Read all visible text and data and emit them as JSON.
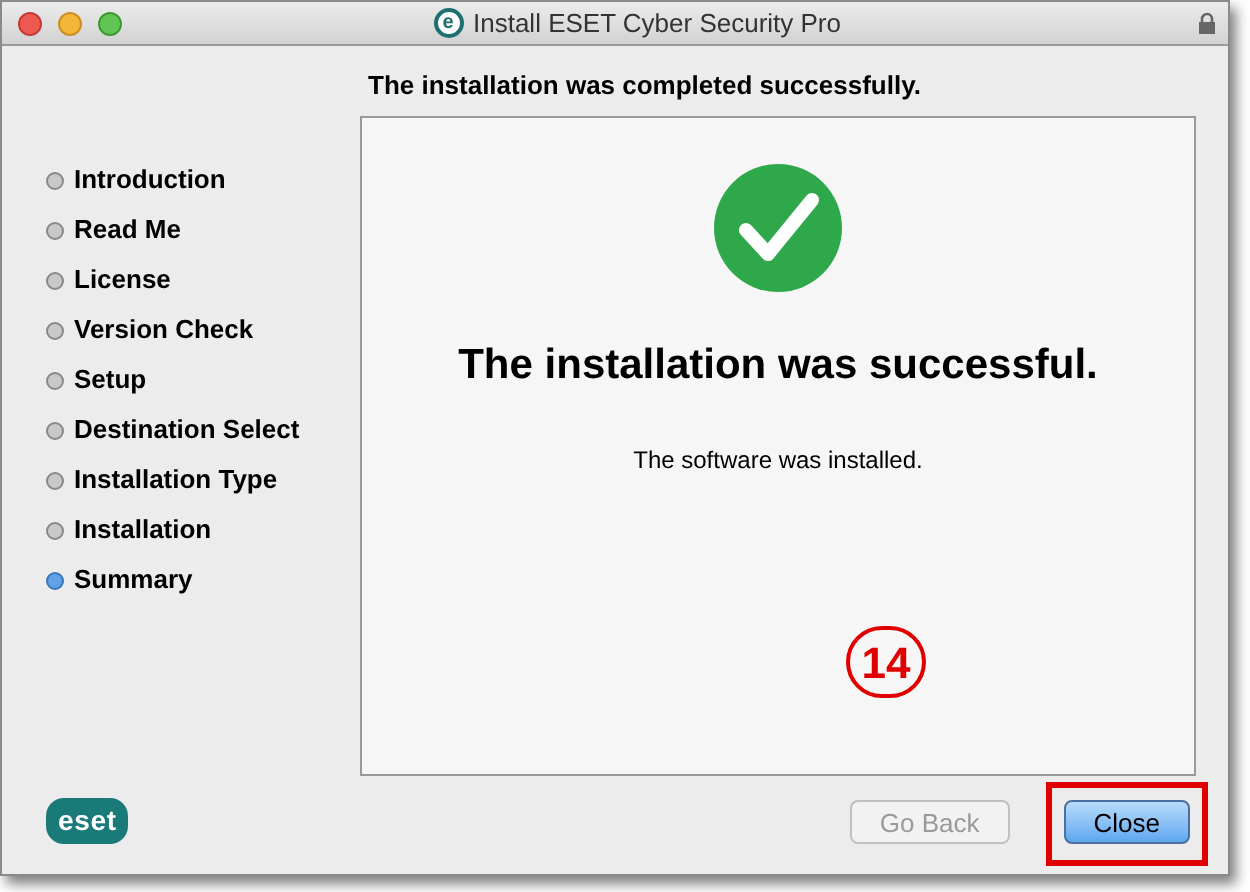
{
  "window": {
    "title": "Install ESET Cyber Security Pro",
    "title_icon": "e"
  },
  "header": "The installation was completed successfully.",
  "steps": [
    {
      "label": "Introduction",
      "selected": false
    },
    {
      "label": "Read Me",
      "selected": false
    },
    {
      "label": "License",
      "selected": false
    },
    {
      "label": "Version Check",
      "selected": false
    },
    {
      "label": "Setup",
      "selected": false
    },
    {
      "label": "Destination Select",
      "selected": false
    },
    {
      "label": "Installation Type",
      "selected": false
    },
    {
      "label": "Installation",
      "selected": false
    },
    {
      "label": "Summary",
      "selected": true
    }
  ],
  "content": {
    "title": "The installation was successful.",
    "message": "The software was installed.",
    "annotation": "14"
  },
  "logo": "eset",
  "buttons": [
    {
      "label": "Go Back",
      "disabled": true,
      "highlighted": false
    },
    {
      "label": "Close",
      "disabled": false,
      "highlighted": true
    }
  ]
}
